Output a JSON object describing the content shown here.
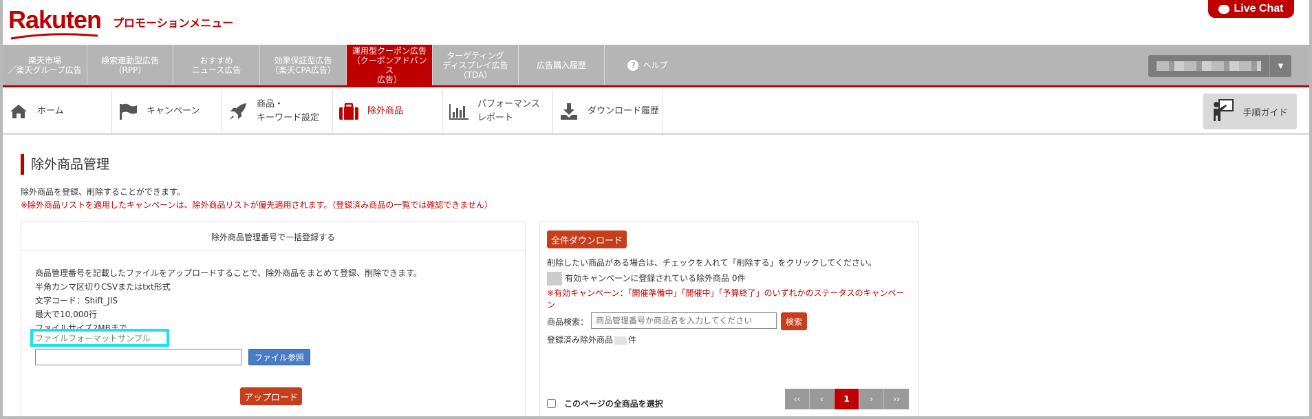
{
  "header": {
    "logo": "Rakuten",
    "title": "プロモーションメニュー",
    "live_chat": "Live Chat"
  },
  "topnav": {
    "items": [
      {
        "label": "楽天市場\n／楽天グループ広告"
      },
      {
        "label": "検索連動型広告\n（RPP）"
      },
      {
        "label": "おすすめ\nニュース広告"
      },
      {
        "label": "効果保証型広告\n（楽天CPA広告）"
      },
      {
        "label": "運用型クーポン広告\n（クーポンアドバンス\n広告）"
      },
      {
        "label": "ターゲティング\nディスプレイ広告\n（TDA）"
      },
      {
        "label": "広告購入履歴"
      }
    ],
    "help": "ヘルプ"
  },
  "subnav": {
    "items": [
      {
        "label": "ホーム",
        "icon": "home-icon"
      },
      {
        "label": "キャンペーン",
        "icon": "flag-icon"
      },
      {
        "label": "商品・\nキーワード設定",
        "icon": "rocket-icon"
      },
      {
        "label": "除外商品",
        "icon": "briefcase-icon"
      },
      {
        "label": "パフォーマンス\nレポート",
        "icon": "bar-chart-icon"
      },
      {
        "label": "ダウンロード履歴",
        "icon": "download-icon"
      }
    ],
    "guide": "手順ガイド"
  },
  "page": {
    "title": "除外商品管理",
    "desc1": "除外商品を登録、削除することができます。",
    "desc2": "※除外商品リストを適用したキャンペーンは、除外商品リストが優先適用されます。（登録済み商品の一覧では確認できません）"
  },
  "left_panel": {
    "title": "除外商品管理番号で一括登録する",
    "info": [
      "商品管理番号を記載したファイルをアップロードすることで、除外商品をまとめて登録、削除できます。",
      "半角カンマ区切りCSVまたはtxt形式",
      "文字コード：Shift_JIS",
      "最大で10,000行",
      "ファイルサイズ2MBまで"
    ],
    "sample_link": "ファイルフォーマットサンプル",
    "browse_label": "ファイル参照",
    "upload_label": "アップロード"
  },
  "right_panel": {
    "download_all": "全件ダウンロード",
    "instruction": "削除したい商品がある場合は、チェックを入れて「削除する」をクリックしてください。",
    "active_count": "有効キャンペーンに登録されている除外商品 0件",
    "active_note": "※有効キャンペーン：「開催準備中」「開催中」「予算終了」のいずれかのステータスのキャンペーン",
    "search_label": "商品検索：",
    "search_placeholder": "商品管理番号か商品名を入力してください",
    "search_button": "検索",
    "registered_prefix": "登録済み除外商品",
    "registered_suffix": "件",
    "select_all": "このページの全商品を選択",
    "pager": {
      "first": "‹‹",
      "prev": "‹",
      "current": "1",
      "next": "›",
      "last": "››"
    }
  },
  "colors": {
    "brand_red": "#bf0000",
    "nav_gray": "#b5b5b5",
    "action_orange": "#c63f1c",
    "browse_blue": "#4a7cc5",
    "highlight_cyan": "#14e5f0"
  }
}
